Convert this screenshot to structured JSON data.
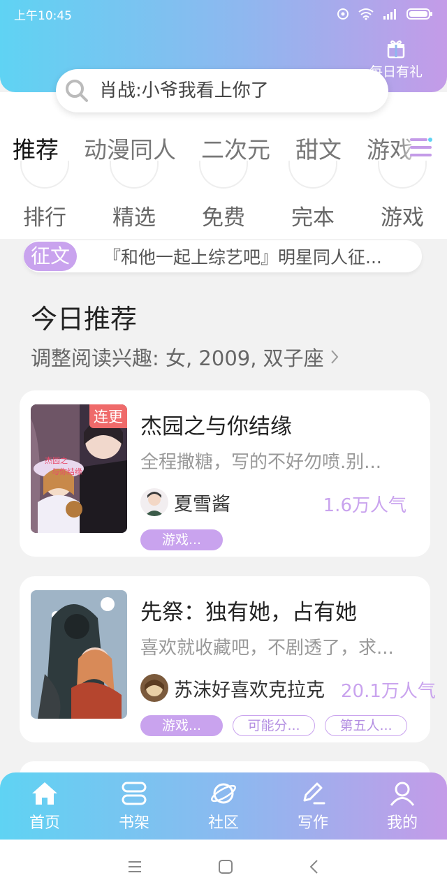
{
  "status": {
    "time": "上午10:45"
  },
  "header": {
    "gift_label": "每日有礼"
  },
  "search": {
    "placeholder": "肖战:小爷我看上你了"
  },
  "tabs": [
    "推荐",
    "动漫同人",
    "二次元",
    "甜文",
    "游戏"
  ],
  "quick_links": [
    "排行",
    "精选",
    "免费",
    "完本",
    "游戏"
  ],
  "contest": {
    "tag": "征文",
    "text": "『和他一起上综艺吧』明星同人征..."
  },
  "section": {
    "title": "今日推荐",
    "subtitle": "调整阅读兴趣: 女, 2009, 双子座"
  },
  "books": [
    {
      "badge": "连更",
      "title": "杰园之与你结缘",
      "desc": "全程撒糖，写的不好勿喷.别...",
      "author": "夏雪酱",
      "popularity": "1.6万人气",
      "tags": [
        "游戏..."
      ]
    },
    {
      "badge": "",
      "title": "先祭：独有她，占有她",
      "desc": "喜欢就收藏吧，不剧透了，求...",
      "author": "苏沫好喜欢克拉克",
      "popularity": "20.1万人气",
      "tags": [
        "游戏...",
        "可能分...",
        "第五人..."
      ]
    }
  ],
  "nav": [
    "首页",
    "书架",
    "社区",
    "写作",
    "我的"
  ],
  "colors": {
    "accent": "#c9a3ee",
    "gradient_start": "#5fd3f3",
    "gradient_end": "#c49be8",
    "badge": "#ef6a6a"
  },
  "icons": [
    "search-icon",
    "gift-icon",
    "menu-icon",
    "home-icon",
    "bookshelf-icon",
    "planet-icon",
    "pen-icon",
    "user-icon"
  ]
}
